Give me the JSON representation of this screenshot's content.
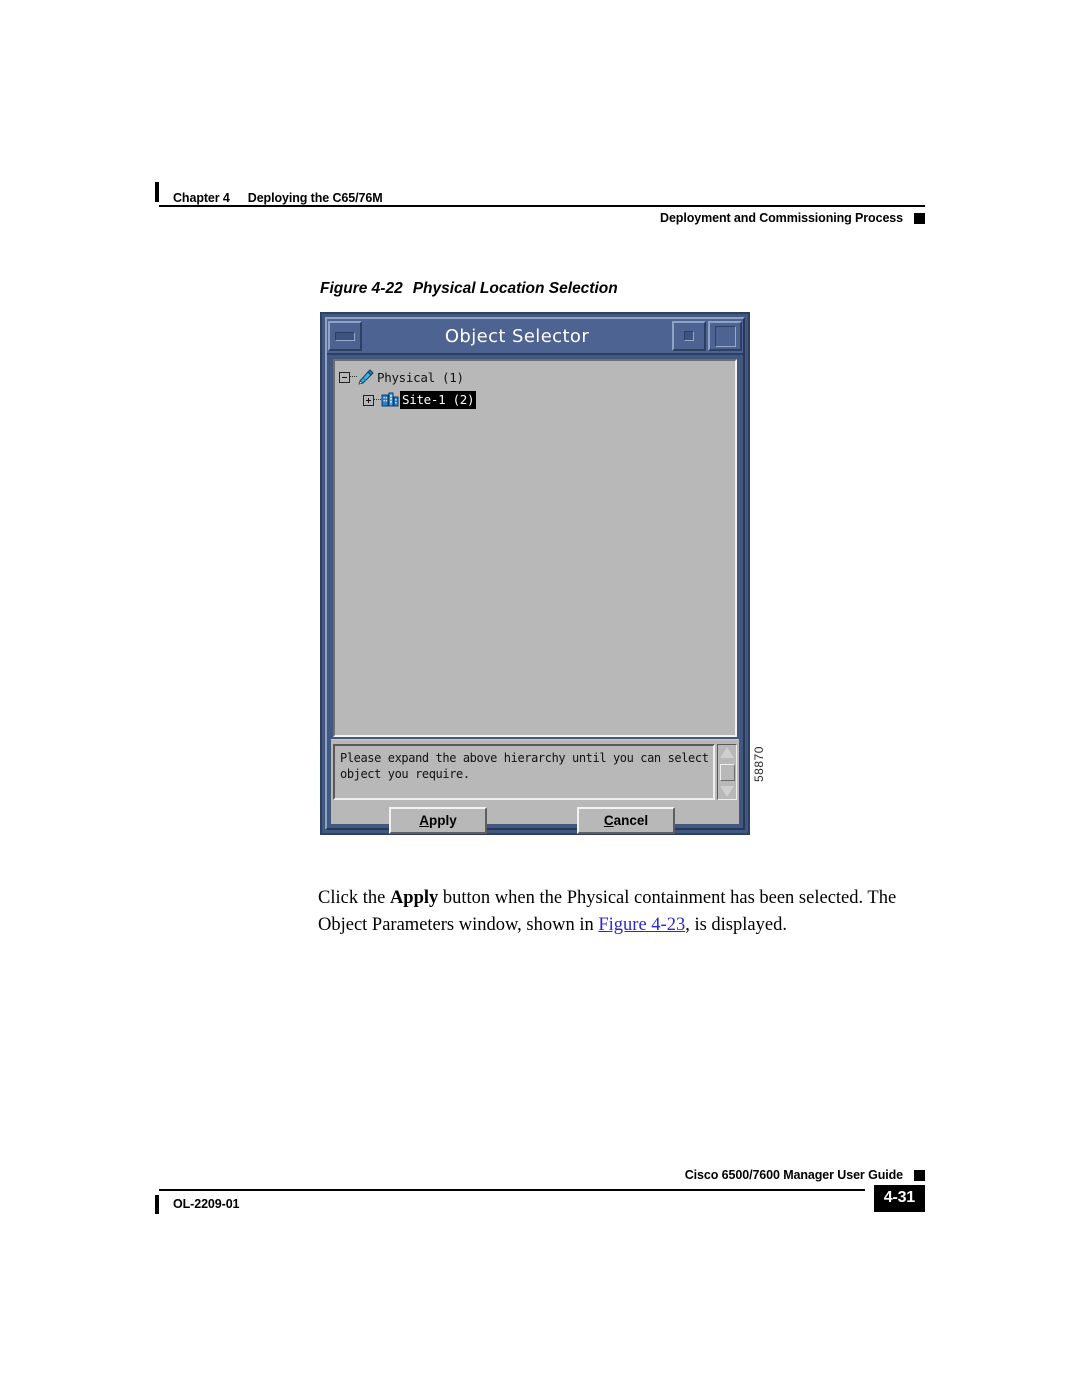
{
  "header": {
    "chapter_label": "Chapter 4",
    "chapter_title": "Deploying the C65/76M",
    "section_title": "Deployment and Commissioning Process"
  },
  "figure": {
    "caption_number": "Figure 4-22",
    "caption_title": "Physical Location Selection",
    "figure_id": "58870",
    "dialog": {
      "title": "Object Selector",
      "titlebar_buttons": {
        "menu": "window-menu-button",
        "minimize": "minimize-button",
        "maximize": "maximize-button"
      },
      "tree": [
        {
          "label": "Physical (1)",
          "expander": "minus",
          "icon": "physical-pencil-icon",
          "selected": false
        },
        {
          "label": "Site-1 (2)",
          "expander": "plus",
          "icon": "site-building-icon",
          "selected": true
        }
      ],
      "message_lines": [
        "Please expand the above hierarchy until you can select the",
        "object you require."
      ],
      "scrollbar": {
        "up_arrow": "scroll-up-arrow",
        "down_arrow": "scroll-down-arrow"
      },
      "buttons": {
        "apply": {
          "mnemonic": "A",
          "rest": "pply"
        },
        "cancel": {
          "mnemonic": "C",
          "rest": "ancel"
        }
      }
    }
  },
  "body": {
    "part1": "Click the ",
    "bold1": "Apply",
    "part2": " button when the Physical containment has been selected. The Object Parameters window, shown in ",
    "link": "Figure 4-23",
    "part3": ", is displayed."
  },
  "footer": {
    "guide_title": "Cisco 6500/7600 Manager User Guide",
    "doc_number": "OL-2209-01",
    "page_number": "4-31"
  },
  "colors": {
    "titlebar_blue": "#4d6391",
    "frame_navy": "#2d3f62",
    "panel_gray": "#b8b8b8",
    "xref_blue": "#2a2ad0"
  }
}
